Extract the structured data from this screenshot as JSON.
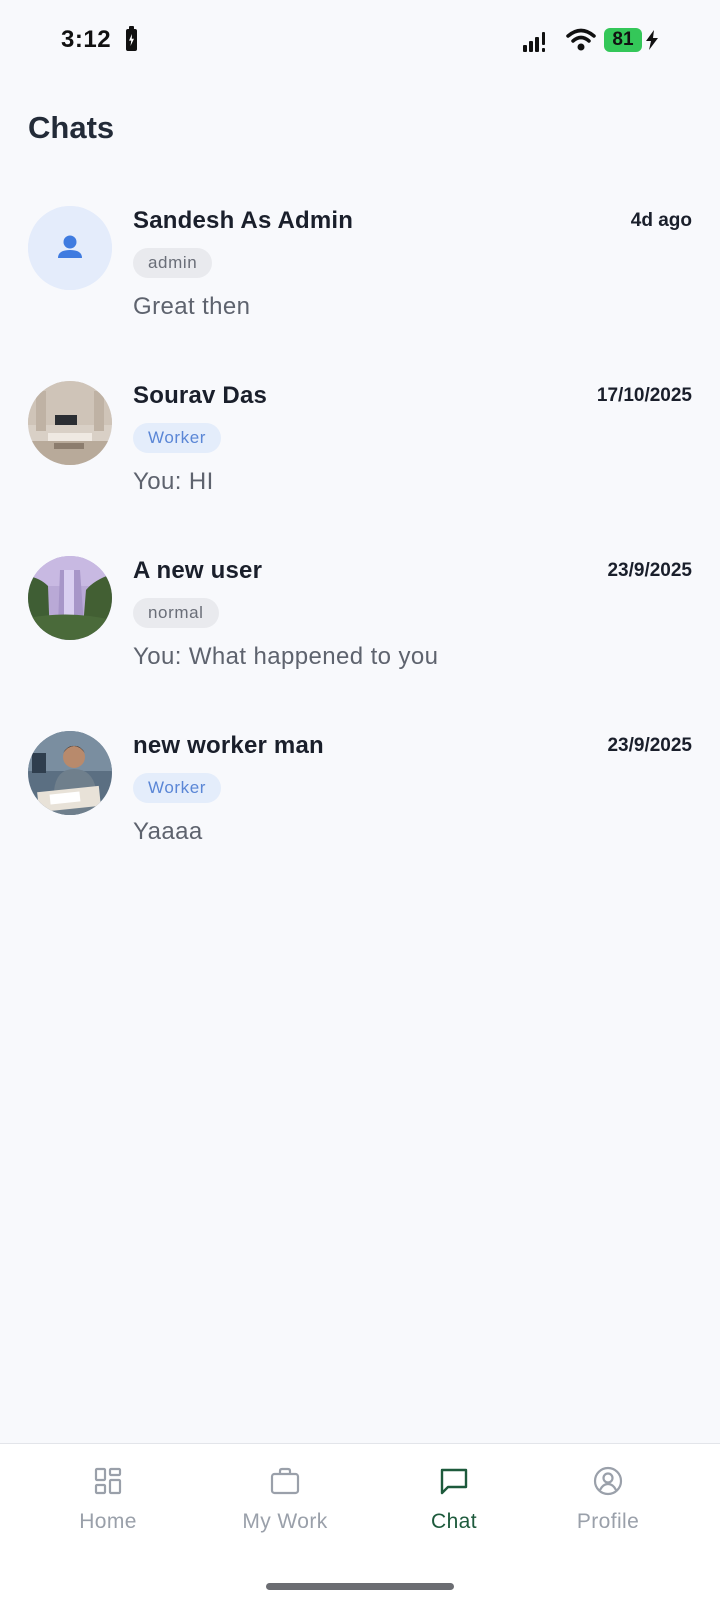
{
  "status_bar": {
    "time": "3:12",
    "battery_level": "81",
    "battery_color": "#34c759"
  },
  "page": {
    "title": "Chats"
  },
  "chats": [
    {
      "name": "Sandesh As Admin",
      "time": "4d ago",
      "role": "admin",
      "preview": "Great then",
      "avatar": "person-icon"
    },
    {
      "name": "Sourav Das",
      "time": "17/10/2025",
      "role": "Worker",
      "preview": "You: HI",
      "avatar": "room-photo"
    },
    {
      "name": "A new user",
      "time": "23/9/2025",
      "role": "normal",
      "preview": "You: What happened to you",
      "avatar": "waterfall-photo"
    },
    {
      "name": "new worker man",
      "time": "23/9/2025",
      "role": "Worker",
      "preview": "Yaaaa",
      "avatar": "man-photo"
    }
  ],
  "bottom_nav": {
    "items": [
      {
        "label": "Home",
        "icon": "grid-icon",
        "active": false
      },
      {
        "label": "My Work",
        "icon": "briefcase-icon",
        "active": false
      },
      {
        "label": "Chat",
        "icon": "chat-bubble-icon",
        "active": true
      },
      {
        "label": "Profile",
        "icon": "user-circle-icon",
        "active": false
      }
    ],
    "active_color": "#1d5a3c",
    "inactive_color": "#9aa0aa"
  }
}
